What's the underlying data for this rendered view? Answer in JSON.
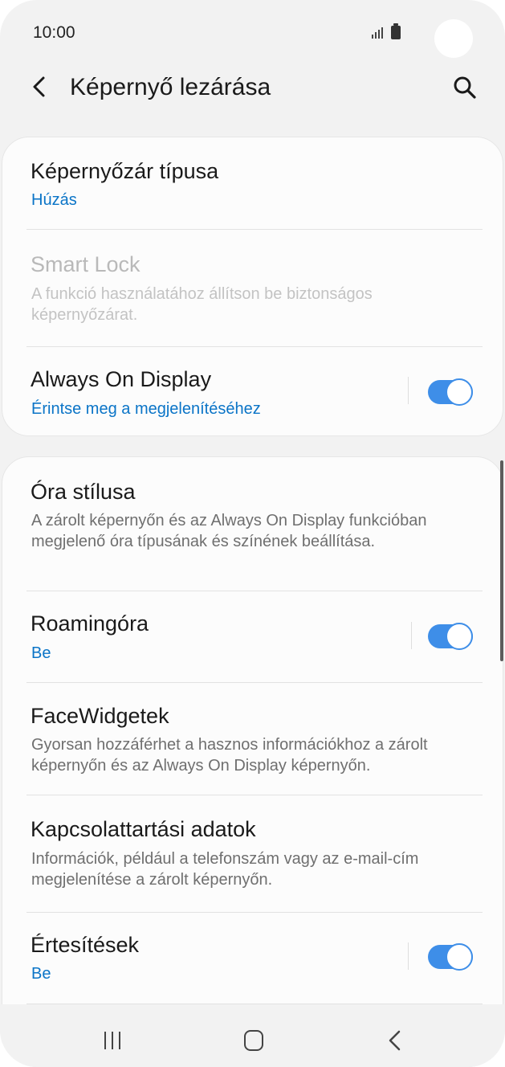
{
  "status_bar": {
    "time": "10:00"
  },
  "header": {
    "title": "Képernyő lezárása"
  },
  "items": [
    {
      "title": "Képernyőzár típusa",
      "subtitle": "Húzás"
    },
    {
      "title": "Smart Lock",
      "description": "A funkció használatához állítson be biztonságos képernyőzárat.",
      "enabled": false
    },
    {
      "title": "Always On Display",
      "subtitle": "Érintse meg a megjelenítéséhez",
      "toggle_on": true
    },
    {
      "title": "Óra stílusa",
      "description": "A zárolt képernyőn és az Always On Display funkcióban megjelenő óra típusának és színének beállítása."
    },
    {
      "title": "Roamingóra",
      "subtitle": "Be",
      "toggle_on": true
    },
    {
      "title": "FaceWidgetek",
      "description": "Gyorsan hozzáférhet a hasznos információkhoz a zárolt képernyőn és az Always On Display képernyőn."
    },
    {
      "title": "Kapcsolattartási adatok",
      "description": "Információk, például a telefonszám vagy az e-mail-cím megjelenítése a zárolt képernyőn."
    },
    {
      "title": "Értesítések",
      "subtitle": "Be",
      "toggle_on": true
    }
  ],
  "colors": {
    "accent": "#0a74c7",
    "toggle": "#3e8ee8",
    "background": "#f2f2f2",
    "card": "#fcfcfc"
  },
  "icons": [
    "back-arrow-icon",
    "search-icon",
    "signal-icon",
    "battery-icon",
    "recents-icon",
    "home-icon",
    "nav-back-icon"
  ]
}
